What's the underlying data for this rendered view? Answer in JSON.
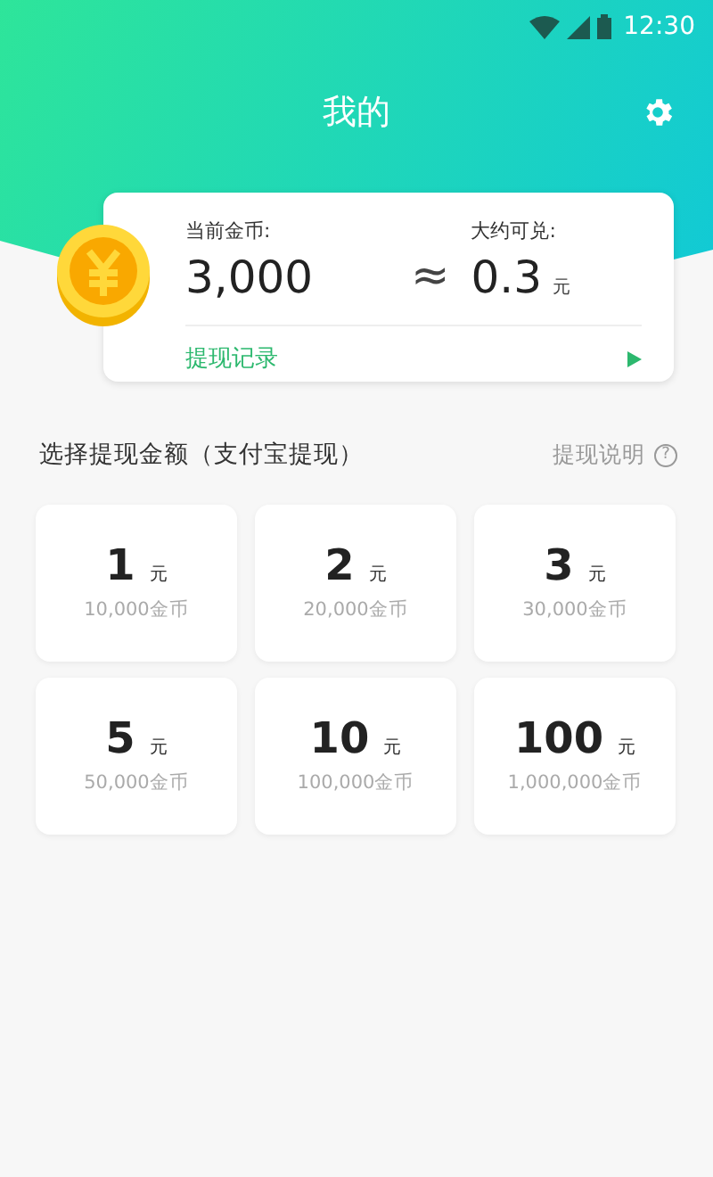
{
  "status_bar": {
    "time": "12:30"
  },
  "header": {
    "title": "我的"
  },
  "balance": {
    "coins_label": "当前金币:",
    "coins": "3,000",
    "approx": "≈",
    "value_label": "大约可兑:",
    "value": "0.3",
    "unit": "元",
    "record_link": "提现记录"
  },
  "withdraw": {
    "heading": "选择提现金额（支付宝提现）",
    "help_link": "提现说明",
    "help_icon": "?",
    "options": [
      {
        "amount": "1",
        "unit": "元",
        "coins": "10,000金币"
      },
      {
        "amount": "2",
        "unit": "元",
        "coins": "20,000金币"
      },
      {
        "amount": "3",
        "unit": "元",
        "coins": "30,000金币"
      },
      {
        "amount": "5",
        "unit": "元",
        "coins": "50,000金币"
      },
      {
        "amount": "10",
        "unit": "元",
        "coins": "100,000金币"
      },
      {
        "amount": "100",
        "unit": "元",
        "coins": "1,000,000金币"
      }
    ]
  }
}
